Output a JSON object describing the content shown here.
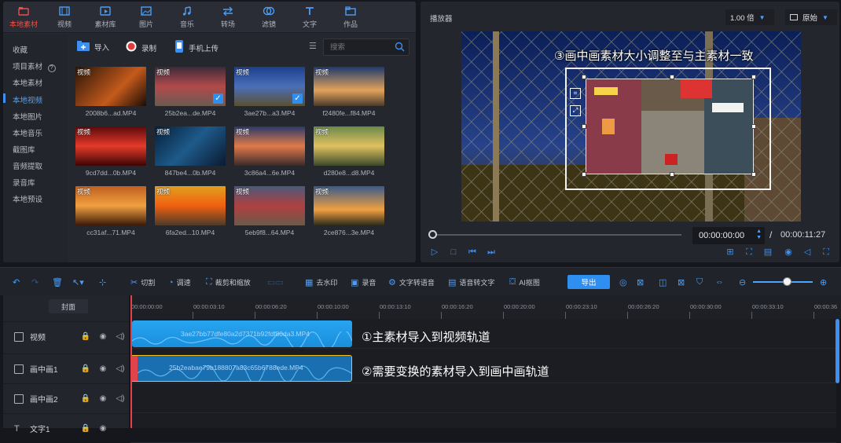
{
  "media_tabs": [
    {
      "label": "本地素材",
      "icon": "folder-icon",
      "active": true
    },
    {
      "label": "视频",
      "icon": "film-icon",
      "active": false
    },
    {
      "label": "素材库",
      "icon": "library-icon",
      "active": false
    },
    {
      "label": "图片",
      "icon": "image-icon",
      "active": false
    },
    {
      "label": "音乐",
      "icon": "music-icon",
      "active": false
    },
    {
      "label": "转场",
      "icon": "transition-icon",
      "active": false
    },
    {
      "label": "滤镜",
      "icon": "filter-icon",
      "active": false
    },
    {
      "label": "文字",
      "icon": "text-icon",
      "active": false
    },
    {
      "label": "作品",
      "icon": "works-icon",
      "active": false
    }
  ],
  "side_nav": [
    {
      "label": "收藏"
    },
    {
      "label": "项目素材"
    },
    {
      "label": "本地素材"
    },
    {
      "label": "本地视频",
      "active": true
    },
    {
      "label": "本地图片"
    },
    {
      "label": "本地音乐"
    },
    {
      "label": "截图库"
    },
    {
      "label": "音频提取"
    },
    {
      "label": "录音库"
    },
    {
      "label": "本地预设"
    }
  ],
  "media_toolbar": {
    "import": "导入",
    "record": "录制",
    "phone_upload": "手机上传",
    "search_placeholder": "搜索"
  },
  "clips": [
    {
      "tag": "视频",
      "name": "2008b6...ad.MP4",
      "checked": false
    },
    {
      "tag": "视频",
      "name": "25b2ea...de.MP4",
      "checked": true
    },
    {
      "tag": "视频",
      "name": "3ae27b...a3.MP4",
      "checked": true
    },
    {
      "tag": "视频",
      "name": "f2480fe...f84.MP4",
      "checked": false
    },
    {
      "tag": "视频",
      "name": "9cd7dd...0b.MP4",
      "checked": false
    },
    {
      "tag": "视频",
      "name": "847be4...0b.MP4",
      "checked": false
    },
    {
      "tag": "视频",
      "name": "3c86a4...6e.MP4",
      "checked": false
    },
    {
      "tag": "视频",
      "name": "d280e8...d8.MP4",
      "checked": false
    },
    {
      "tag": "视频",
      "name": "cc31af...71.MP4",
      "checked": false
    },
    {
      "tag": "视频",
      "name": "6fa2ed...10.MP4",
      "checked": false
    },
    {
      "tag": "视频",
      "name": "5eb9f8...64.MP4",
      "checked": false
    },
    {
      "tag": "视频",
      "name": "2ce876...3e.MP4",
      "checked": false
    }
  ],
  "player": {
    "title": "播放器",
    "speed": "1.00 倍",
    "ratio": "原始",
    "overlay_text": "③画中画素材大小调整至与主素材一致",
    "current_time": "00:00:00:00",
    "separator": "/",
    "total_time": "00:00:11:27",
    "progress": 0
  },
  "timeline_toolbar": {
    "cut": "切割",
    "speed": "调速",
    "crop_zoom": "裁剪和缩放",
    "remove_watermark": "去水印",
    "record_audio": "录音",
    "text_to_speech": "文字转语音",
    "speech_to_text": "语音转文字",
    "ai_cutout": "AI抠图",
    "export": "导出",
    "zoom_level": 0.55
  },
  "timeline": {
    "cover_label": "封面",
    "ruler_ticks": [
      "00:00:00:00",
      "00:00:03:10",
      "00:00:06:20",
      "00:00:10:00",
      "00:00:13:10",
      "00:00:16:20",
      "00:00:20:00",
      "00:00:23:10",
      "00:00:26:20",
      "00:00:30:00",
      "00:00:33:10",
      "00:00:36"
    ],
    "tracks": [
      {
        "name": "视频",
        "icon": "video-track-icon"
      },
      {
        "name": "画中画1",
        "icon": "pip-track-icon"
      },
      {
        "name": "画中画2",
        "icon": "pip-track-icon"
      },
      {
        "name": "文字1",
        "icon": "text-track-icon"
      }
    ],
    "main_clip": "3ae27bb77dfe80a2d7371b92fdf80da3.MP4",
    "pip_clip": "25b2eabae79b188807a83c65b6788ede.MP4",
    "note1": "①主素材导入到视频轨道",
    "note2": "②需要变换的素材导入到画中画轨道"
  }
}
